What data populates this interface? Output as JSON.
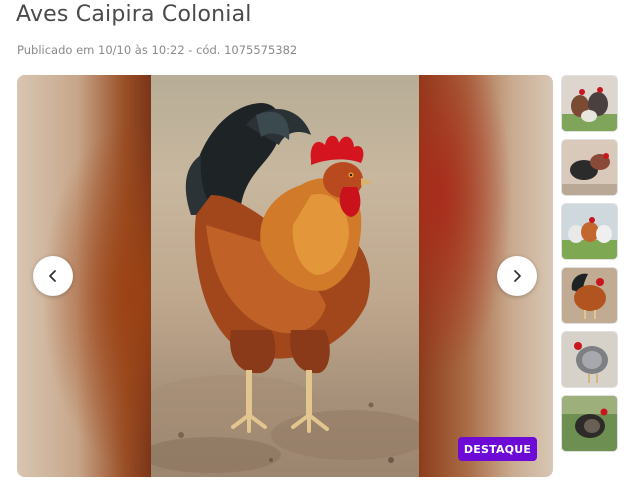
{
  "listing": {
    "title": "Aves Caipira Colonial",
    "meta": "Publicado em 10/10 às 10:22 - cód. 1075575382"
  },
  "gallery": {
    "badge": "DESTAQUE",
    "prev_icon": "chevron-left-icon",
    "next_icon": "chevron-right-icon",
    "main_image": "rooster-photo",
    "thumbnails": [
      {
        "name": "thumbnail-1"
      },
      {
        "name": "thumbnail-2"
      },
      {
        "name": "thumbnail-3"
      },
      {
        "name": "thumbnail-4"
      },
      {
        "name": "thumbnail-5"
      },
      {
        "name": "thumbnail-6"
      }
    ]
  },
  "colors": {
    "badge": "#6e0ad6",
    "title": "#4a4a4a",
    "meta": "#8a8a8a"
  }
}
